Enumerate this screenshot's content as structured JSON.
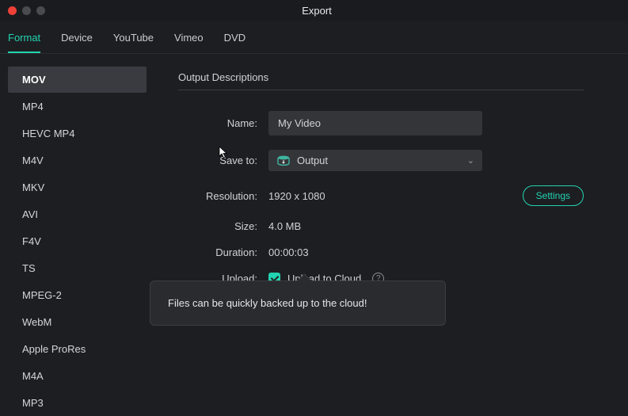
{
  "window": {
    "title": "Export"
  },
  "tabs": [
    {
      "label": "Format",
      "active": true
    },
    {
      "label": "Device",
      "active": false
    },
    {
      "label": "YouTube",
      "active": false
    },
    {
      "label": "Vimeo",
      "active": false
    },
    {
      "label": "DVD",
      "active": false
    }
  ],
  "sidebar": {
    "items": [
      {
        "label": "MOV",
        "active": true
      },
      {
        "label": "MP4"
      },
      {
        "label": "HEVC MP4"
      },
      {
        "label": "M4V"
      },
      {
        "label": "MKV"
      },
      {
        "label": "AVI"
      },
      {
        "label": "F4V"
      },
      {
        "label": "TS"
      },
      {
        "label": "MPEG-2"
      },
      {
        "label": "WebM"
      },
      {
        "label": "Apple ProRes"
      },
      {
        "label": "M4A"
      },
      {
        "label": "MP3"
      }
    ]
  },
  "output": {
    "section_title": "Output Descriptions",
    "labels": {
      "name": "Name:",
      "saveto": "Save to:",
      "resolution": "Resolution:",
      "size": "Size:",
      "duration": "Duration:",
      "upload": "Upload:"
    },
    "name_value": "My Video",
    "saveto_value": "Output",
    "resolution_value": "1920 x 1080",
    "size_value": "4.0 MB",
    "duration_value": "00:00:03",
    "upload_label": "Upload to Cloud",
    "settings_button": "Settings",
    "tooltip": "Files can be quickly backed up to the cloud!"
  }
}
